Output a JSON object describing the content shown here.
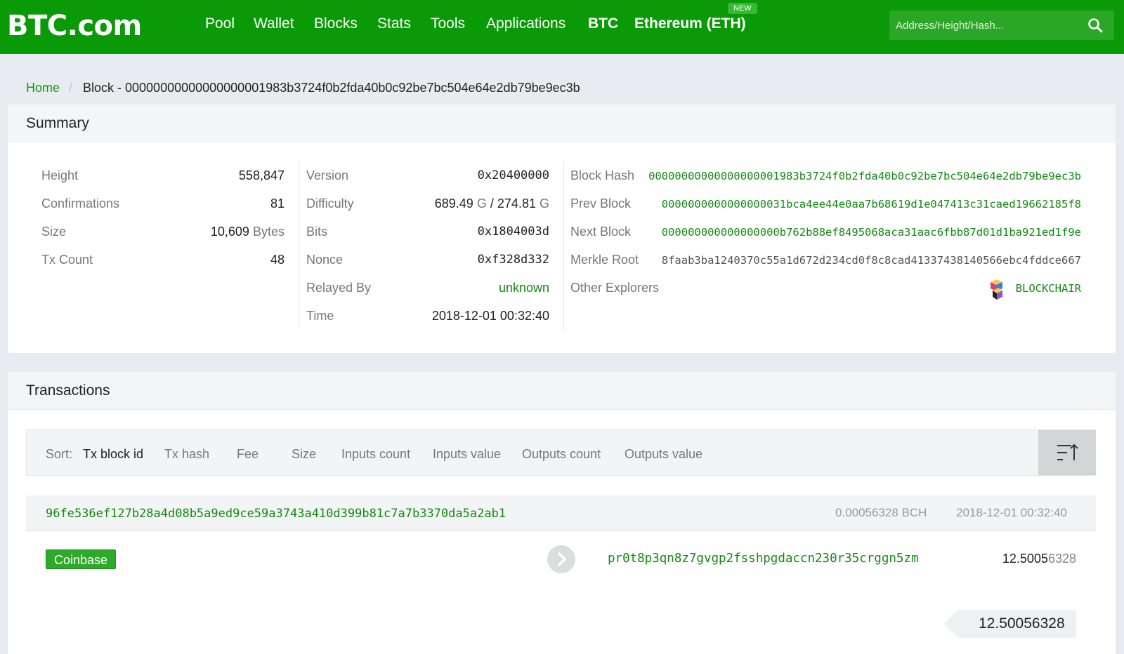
{
  "header": {
    "logo": "BTC.com",
    "nav": [
      "Pool",
      "Wallet",
      "Blocks",
      "Stats",
      "Tools",
      "Applications",
      "BTC",
      "Ethereum (ETH)"
    ],
    "new_badge": "NEW",
    "search_placeholder": "Address/Height/Hash..."
  },
  "breadcrumb": {
    "home": "Home",
    "separator": "/",
    "current": "Block - 00000000000000000001983b3724f0b2fda40b0c92be7bc504e64e2db79be9ec3b"
  },
  "summary": {
    "title": "Summary",
    "col1": [
      {
        "label": "Height",
        "value": "558,847"
      },
      {
        "label": "Confirmations",
        "value": "81"
      },
      {
        "label": "Size",
        "value": "10,609",
        "unit": "Bytes"
      },
      {
        "label": "Tx Count",
        "value": "48"
      }
    ],
    "col2": {
      "version_label": "Version",
      "version": "0x20400000",
      "difficulty_label": "Difficulty",
      "difficulty_a": "689.49",
      "difficulty_unit_a": "G",
      "difficulty_sep": "/",
      "difficulty_b": "274.81",
      "difficulty_unit_b": "G",
      "bits_label": "Bits",
      "bits": "0x1804003d",
      "nonce_label": "Nonce",
      "nonce": "0xf328d332",
      "relayed_label": "Relayed By",
      "relayed": "unknown",
      "time_label": "Time",
      "time": "2018-12-01 00:32:40"
    },
    "col3": {
      "block_hash_label": "Block Hash",
      "block_hash": "00000000000000000001983b3724f0b2fda40b0c92be7bc504e64e2db79be9ec3b",
      "prev_label": "Prev Block",
      "prev": "0000000000000000031bca4ee44e0aa7b68619d1e047413c31caed19662185f8",
      "next_label": "Next Block",
      "next": "000000000000000000b762b88ef8495068aca31aac6fbb87d01d1ba921ed1f9e",
      "merkle_label": "Merkle Root",
      "merkle": "8faab3ba1240370c55a1d672d234cd0f8c8cad41337438140566ebc4fddce667",
      "explorers_label": "Other Explorers",
      "explorer": "BLOCKCHAIR"
    }
  },
  "transactions": {
    "title": "Transactions",
    "sort_label": "Sort:",
    "sort_options": [
      "Tx block id",
      "Tx hash",
      "Fee",
      "Size",
      "Inputs count",
      "Inputs value",
      "Outputs count",
      "Outputs value"
    ],
    "active_sort": "Tx block id",
    "tx": {
      "hash": "96fe536ef127b28a4d08b5a9ed9ce59a3743a410d399b81c7a7b3370da5a2ab1",
      "fee": "0.00056328 BCH",
      "time": "2018-12-01 00:32:40",
      "input_label": "Coinbase",
      "output_address": "pr0t8p3qn8z7gvgp2fsshpgdaccn230r35crggn5zm",
      "output_value_main": "12.5005",
      "output_value_rest": "6328",
      "total": "12.50056328"
    }
  },
  "colors": {
    "brand_green": "#0b9a07",
    "link_green": "#128a10",
    "coinbase_badge": "#2eaa2a"
  }
}
